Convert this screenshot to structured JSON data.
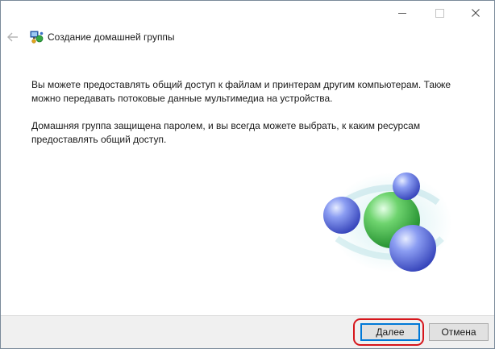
{
  "window": {
    "title": "Создание домашней группы",
    "controls": {
      "minimize": "minimize-icon",
      "maximize": "maximize-icon",
      "close": "close-icon"
    }
  },
  "navigation": {
    "back_icon": "back-arrow-icon"
  },
  "header": {
    "icon": "homegroup-icon",
    "title": "Создание домашней группы"
  },
  "content": {
    "paragraph1": "Вы можете предоставлять общий доступ к файлам и принтерам другим компьютерам. Также можно передавать потоковые данные мультимедиа на устройства.",
    "paragraph2": "Домашняя группа защищена паролем, и вы всегда можете выбрать, к каким ресурсам предоставлять общий доступ."
  },
  "graphic": {
    "icon": "homegroup-spheres-graphic"
  },
  "footer": {
    "next_label": "Далее",
    "cancel_label": "Отмена"
  },
  "colors": {
    "accent": "#0078d7",
    "highlight": "#d6161c",
    "footer_bg": "#f0f0f0",
    "sphere_blue": "#5a6fe0",
    "sphere_green": "#3fb84a"
  }
}
